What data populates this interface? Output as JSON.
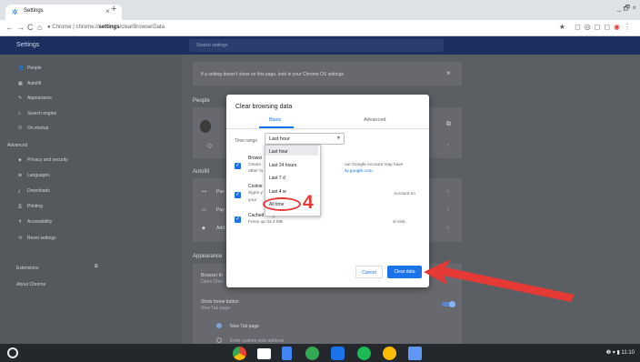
{
  "browser": {
    "tab_title": "Settings",
    "tab_close": "×",
    "new_tab": "+",
    "window_controls": "_ 🗗 ×",
    "url_scheme": "Chrome | chrome://",
    "url_bold": "settings",
    "url_rest": "/clearBrowserData",
    "back": "←",
    "forward": "→",
    "reload": "C",
    "home": "⌂",
    "lock": "●",
    "star": "★",
    "menu": "⋮"
  },
  "settings": {
    "header_title": "Settings",
    "search_placeholder": "Search settings",
    "sidebar": [
      {
        "icon": "person-icon",
        "glyph": "👤",
        "label": "People"
      },
      {
        "icon": "autofill-icon",
        "glyph": "▦",
        "label": "Autofill"
      },
      {
        "icon": "palette-icon",
        "glyph": "✎",
        "label": "Appearance"
      },
      {
        "icon": "search-icon",
        "glyph": "⌕",
        "label": "Search engine"
      },
      {
        "icon": "power-icon",
        "glyph": "⏻",
        "label": "On startup"
      }
    ],
    "advanced_label": "Advanced",
    "advanced_items": [
      {
        "icon": "shield-icon",
        "glyph": "◈",
        "label": "Privacy and security"
      },
      {
        "icon": "globe-icon",
        "glyph": "⊕",
        "label": "Languages"
      },
      {
        "icon": "download-icon",
        "glyph": "⤓",
        "label": "Downloads"
      },
      {
        "icon": "printer-icon",
        "glyph": "⎙",
        "label": "Printing"
      },
      {
        "icon": "accessibility-icon",
        "glyph": "✝",
        "label": "Accessibility"
      },
      {
        "icon": "reset-icon",
        "glyph": "⟲",
        "label": "Reset settings"
      }
    ],
    "extensions_label": "Extensions",
    "about_label": "About Chrome",
    "notice": "If a setting doesn't show on this page, look in your Chrome OS settings",
    "section_people": "People",
    "section_autofill": "Autofill",
    "section_appearance": "Appearance",
    "browser_theme": "Browser th",
    "open_chrome": "Open Chro",
    "show_home_button": "Show home button",
    "new_tab_page_sub": "New Tab page",
    "radio_new_tab": "New Tab page",
    "radio_custom": "Enter custom web address",
    "pas_partial": "Pas",
    "pay_partial": "Pay",
    "add_partial": "Add"
  },
  "dialog": {
    "title": "Clear browsing data",
    "tab_basic": "Basic",
    "tab_advanced": "Advanced",
    "time_range_label": "Time range",
    "time_range_value": "Last hour",
    "dropdown_options": [
      "Last hour",
      "Last 24 hours",
      "Last 7 d",
      "Last 4 w",
      "All time"
    ],
    "items": [
      {
        "title": "Browsi",
        "sub": "Clears",
        "sub2": "other fo"
      },
      {
        "title": "Cookie",
        "sub": "Signs y",
        "sub2": "your"
      },
      {
        "title": "Cached images a",
        "sub": "Frees up 34.3 MB"
      }
    ],
    "right_text_1": "our Google Account may have",
    "right_link": "ity.google.com.",
    "right_text_2": "Account so",
    "right_text_3": "xt visit.",
    "cancel": "Cancel",
    "clear": "Clear data"
  },
  "annotation": {
    "step_number": "4",
    "color": "#e53935"
  },
  "system": {
    "time": "11:10"
  }
}
